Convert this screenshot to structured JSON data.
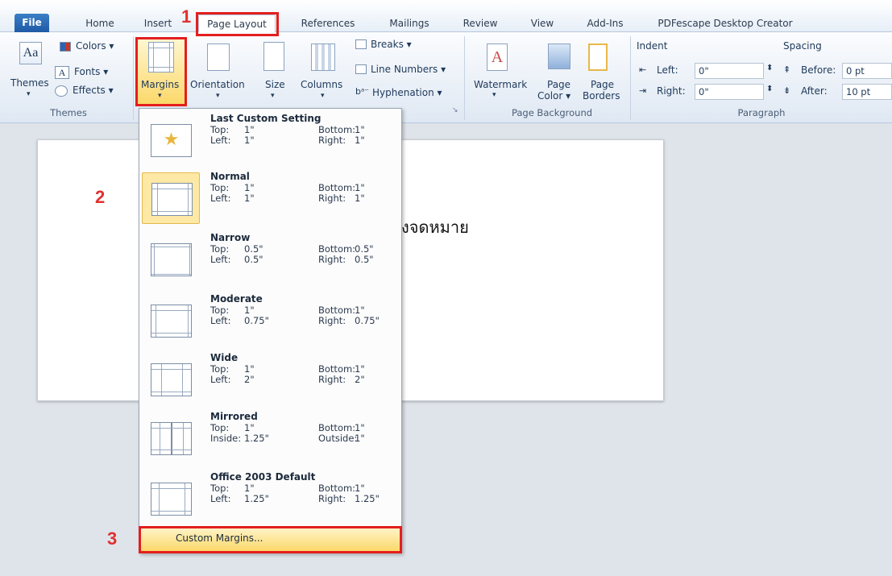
{
  "tabs": {
    "file": "File",
    "home": "Home",
    "insert": "Insert",
    "page_layout": "Page Layout",
    "references": "References",
    "mailings": "Mailings",
    "review": "Review",
    "view": "View",
    "addins": "Add-Ins",
    "pdfescape": "PDFescape Desktop Creator"
  },
  "ribbon": {
    "themes": {
      "themes": "Themes",
      "colors": "Colors ▾",
      "fonts": "Fonts ▾",
      "effects": "Effects ▾",
      "group": "Themes"
    },
    "page_setup": {
      "margins": "Margins",
      "orientation": "Orientation",
      "size": "Size",
      "columns": "Columns",
      "breaks": "Breaks ▾",
      "line_numbers": "Line Numbers ▾",
      "hyphenation": "Hyphenation ▾"
    },
    "page_background": {
      "watermark": "Watermark",
      "page_color": "Page",
      "page_color2": "Color ▾",
      "page_borders": "Page",
      "page_borders2": "Borders",
      "group": "Page Background"
    },
    "paragraph": {
      "indent": "Indent",
      "spacing": "Spacing",
      "left_label": "Left:",
      "left_value": "0\"",
      "right_label": "Right:",
      "right_value": "0\"",
      "before_label": "Before:",
      "before_value": "0 pt",
      "after_label": "After:",
      "after_value": "10 pt",
      "group": "Paragraph"
    }
  },
  "document": {
    "text": "งจดหมาย"
  },
  "margins_menu": {
    "items": [
      {
        "name": "Last Custom Setting",
        "l1": "Top:",
        "v1": "1\"",
        "l2": "Bottom:",
        "v2": "1\"",
        "l3": "Left:",
        "v3": "1\"",
        "l4": "Right:",
        "v4": "1\""
      },
      {
        "name": "Normal",
        "l1": "Top:",
        "v1": "1\"",
        "l2": "Bottom:",
        "v2": "1\"",
        "l3": "Left:",
        "v3": "1\"",
        "l4": "Right:",
        "v4": "1\""
      },
      {
        "name": "Narrow",
        "l1": "Top:",
        "v1": "0.5\"",
        "l2": "Bottom:",
        "v2": "0.5\"",
        "l3": "Left:",
        "v3": "0.5\"",
        "l4": "Right:",
        "v4": "0.5\""
      },
      {
        "name": "Moderate",
        "l1": "Top:",
        "v1": "1\"",
        "l2": "Bottom:",
        "v2": "1\"",
        "l3": "Left:",
        "v3": "0.75\"",
        "l4": "Right:",
        "v4": "0.75\""
      },
      {
        "name": "Wide",
        "l1": "Top:",
        "v1": "1\"",
        "l2": "Bottom:",
        "v2": "1\"",
        "l3": "Left:",
        "v3": "2\"",
        "l4": "Right:",
        "v4": "2\""
      },
      {
        "name": "Mirrored",
        "l1": "Top:",
        "v1": "1\"",
        "l2": "Bottom:",
        "v2": "1\"",
        "l3": "Inside:",
        "v3": "1.25\"",
        "l4": "Outside:",
        "v4": "1\""
      },
      {
        "name": "Office 2003 Default",
        "l1": "Top:",
        "v1": "1\"",
        "l2": "Bottom:",
        "v2": "1\"",
        "l3": "Left:",
        "v3": "1.25\"",
        "l4": "Right:",
        "v4": "1.25\""
      }
    ],
    "custom": "Custom Margins..."
  },
  "steps": {
    "s1": "1",
    "s2": "2",
    "s3": "3"
  },
  "colors": {
    "annotation_red": "#e41e1e",
    "highlight": "#fbd86a",
    "file_tab": "#2a67b3"
  }
}
